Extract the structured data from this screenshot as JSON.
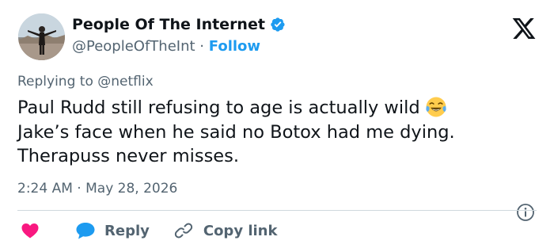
{
  "author": {
    "name": "People Of The Internet",
    "handle": "@PeopleOfTheInt",
    "separator": "·",
    "follow_label": "Follow"
  },
  "reply_context": "Replying to @netflix",
  "tweet": {
    "lines": [
      "Paul Rudd still refusing to age is actually wild",
      "Jake’s face when he said no Botox had me dying.",
      "Therapuss never misses."
    ],
    "emoji": "face-with-tears-of-joy"
  },
  "meta": {
    "time": "2:24 AM",
    "separator": "·",
    "date": "May 28, 2026"
  },
  "actions": {
    "reply_label": "Reply",
    "copy_link_label": "Copy link"
  },
  "colors": {
    "brand_blue": "#1d9bf0",
    "like_pink": "#f91880",
    "text": "#0f1419",
    "secondary": "#536471",
    "divider": "#cfd9de"
  },
  "icons": [
    "verified-badge-icon",
    "x-logo-icon",
    "info-icon",
    "heart-icon",
    "comment-bubble-icon",
    "link-icon"
  ]
}
